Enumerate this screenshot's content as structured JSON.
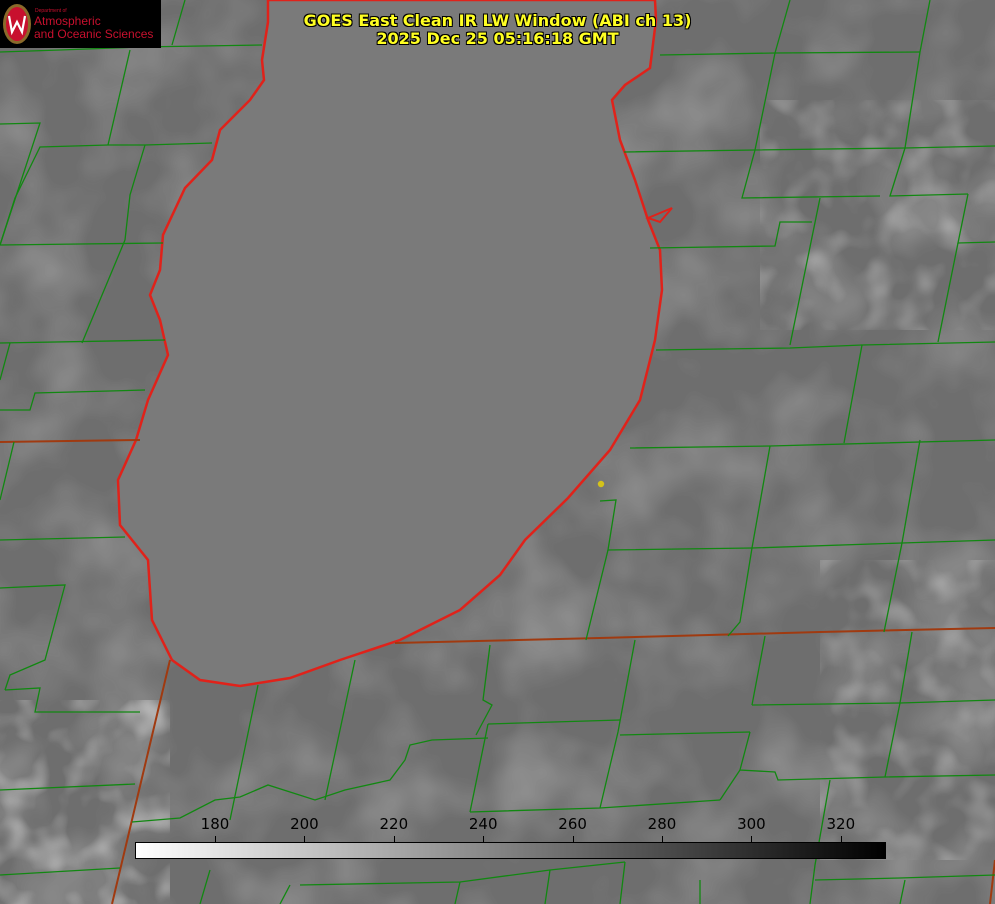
{
  "title": {
    "line1": "GOES East Clean IR LW Window (ABI ch 13)",
    "line2": "2025 Dec 25 05:16:18 GMT"
  },
  "logo": {
    "department": "Department of",
    "line1": "Atmospheric",
    "line2": "and Oceanic Sciences",
    "brand_color": "#c8102e"
  },
  "colorbar": {
    "ticks": [
      "180",
      "200",
      "220",
      "240",
      "260",
      "280",
      "300",
      "320"
    ],
    "gradient_start": "#ffffff",
    "gradient_end": "#000000"
  },
  "map_colors": {
    "lake_outline": "#e0221a",
    "county_lines": "#118811",
    "state_lines": "#a03a10",
    "marker": "#d4c21a"
  }
}
